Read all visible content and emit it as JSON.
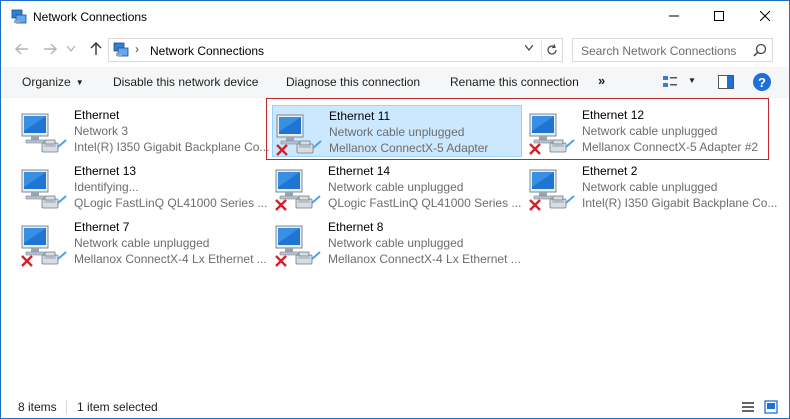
{
  "window": {
    "title": "Network Connections",
    "icons": {
      "app": "network-connections-icon",
      "minimize": "minimize-icon",
      "maximize": "maximize-icon",
      "close": "close-icon"
    }
  },
  "address": {
    "path": "Network Connections",
    "separator": "›",
    "search_placeholder": "Search Network Connections",
    "icons": {
      "back": "back-arrow-icon",
      "forward": "forward-arrow-icon",
      "up": "up-arrow-icon",
      "refresh": "refresh-icon",
      "search": "search-icon"
    }
  },
  "commands": {
    "organize": "Organize",
    "disable": "Disable this network device",
    "diagnose": "Diagnose this connection",
    "rename": "Rename this connection",
    "more": "»",
    "help": "?"
  },
  "items": [
    {
      "name": "Ethernet",
      "status": "Network  3",
      "device": "Intel(R) I350 Gigabit Backplane Co...",
      "unplugged": false,
      "selected": false
    },
    {
      "name": "Ethernet 11",
      "status": "Network cable unplugged",
      "device": "Mellanox ConnectX-5 Adapter",
      "unplugged": true,
      "selected": true
    },
    {
      "name": "Ethernet 12",
      "status": "Network cable unplugged",
      "device": "Mellanox ConnectX-5 Adapter #2",
      "unplugged": true,
      "selected": false
    },
    {
      "name": "Ethernet 13",
      "status": "Identifying...",
      "device": "QLogic FastLinQ QL41000 Series ...",
      "unplugged": false,
      "selected": false
    },
    {
      "name": "Ethernet 14",
      "status": "Network cable unplugged",
      "device": "QLogic FastLinQ QL41000 Series ...",
      "unplugged": true,
      "selected": false
    },
    {
      "name": "Ethernet 2",
      "status": "Network cable unplugged",
      "device": "Intel(R) I350 Gigabit Backplane Co...",
      "unplugged": true,
      "selected": false
    },
    {
      "name": "Ethernet 7",
      "status": "Network cable unplugged",
      "device": "Mellanox ConnectX-4 Lx Ethernet ...",
      "unplugged": true,
      "selected": false
    },
    {
      "name": "Ethernet 8",
      "status": "Network cable unplugged",
      "device": "Mellanox ConnectX-4 Lx Ethernet ...",
      "unplugged": true,
      "selected": false
    }
  ],
  "status": {
    "count": "8 items",
    "selection": "1 item selected"
  },
  "colors": {
    "selection_bg": "#cce8ff",
    "selection_border": "#99d1ff",
    "highlight_border": "#c0282d",
    "accent": "#1e6fd9",
    "error_x": "#d6202a"
  }
}
